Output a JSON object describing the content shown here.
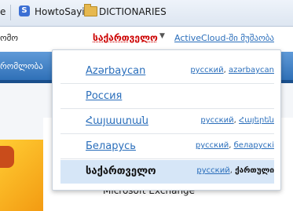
{
  "bookmarks": {
    "fragment_left": "e",
    "howto_label": "HowtoSayin?",
    "dictionaries_label": "DICTIONARIES"
  },
  "header": {
    "fragment_left": "ომო",
    "language_selector": "საქართველო",
    "activecloud_link": "ActiveCloud-ში მუშაობა"
  },
  "nav": {
    "fragment_left": "რომლობა"
  },
  "content": {
    "microsoft_exchange": "Microsoft Exchange"
  },
  "dropdown": {
    "items": [
      {
        "country": "Azərbaycan",
        "lang1": "русский",
        "lang2": "azərbaycan"
      },
      {
        "country": "Россия"
      },
      {
        "country": "Հայաստան",
        "lang1": "русский",
        "lang2": "Հայերեն"
      },
      {
        "country": "Беларусь",
        "lang1": "русский",
        "lang2": "беларускі"
      },
      {
        "country": "საქართველო",
        "lang1": "русский",
        "lang2": "ქართული"
      }
    ]
  },
  "colors": {
    "accent_red": "#cc0000",
    "link_blue": "#2a6ebb",
    "nav_blue": "#2f70b7",
    "selected_row": "#d6e6f7"
  },
  "icons": [
    "s-site-icon",
    "question-page-icon",
    "folder-icon",
    "dropdown-caret-icon"
  ]
}
